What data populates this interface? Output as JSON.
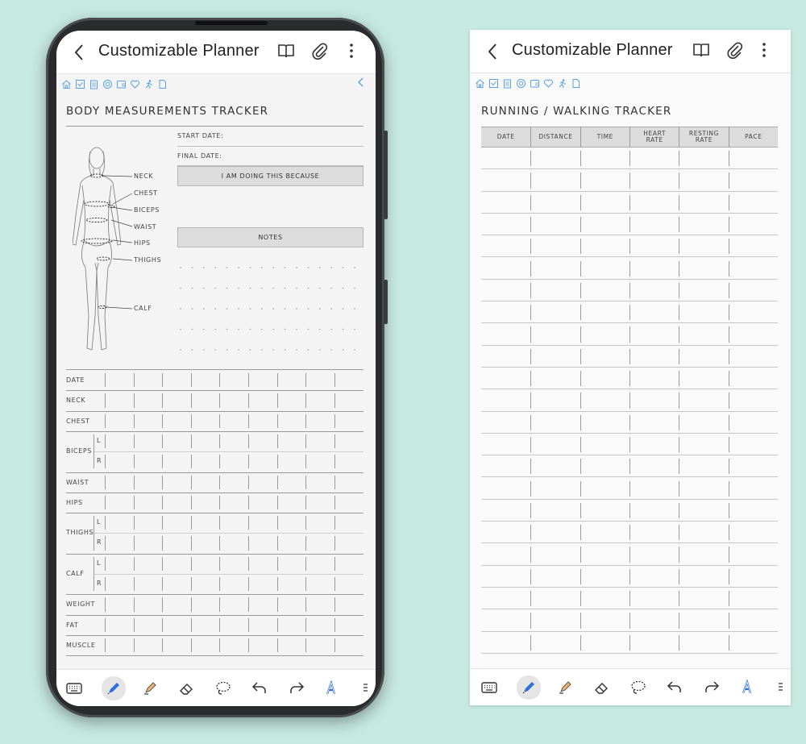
{
  "app_title": "Customizable Planner",
  "nav_icons": [
    "home-icon",
    "inbox-icon",
    "clipboard-icon",
    "target-icon",
    "wallet-icon",
    "heart-icon",
    "run-icon",
    "page-icon"
  ],
  "body_tracker": {
    "title": "BODY MEASUREMENTS TRACKER",
    "start_date": "START DATE:",
    "final_date": "FINAL DATE:",
    "because": "I AM DOING THIS BECAUSE",
    "notes": "NOTES",
    "figure_labels": [
      "NECK",
      "CHEST",
      "BICEPS",
      "WAIST",
      "HIPS",
      "THIGHS",
      "CALF"
    ],
    "rows": [
      {
        "label": "DATE",
        "sub": ""
      },
      {
        "label": "NECK",
        "sub": ""
      },
      {
        "label": "CHEST",
        "sub": ""
      },
      {
        "label": "BICEPS",
        "sub": "L"
      },
      {
        "label": "",
        "sub": "R"
      },
      {
        "label": "WAIST",
        "sub": ""
      },
      {
        "label": "HIPS",
        "sub": ""
      },
      {
        "label": "THIGHS",
        "sub": "L"
      },
      {
        "label": "",
        "sub": "R"
      },
      {
        "label": "CALF",
        "sub": "L"
      },
      {
        "label": "",
        "sub": "R"
      },
      {
        "label": "WEIGHT",
        "sub": ""
      },
      {
        "label": "FAT",
        "sub": ""
      },
      {
        "label": "MUSCLE",
        "sub": ""
      }
    ]
  },
  "run_tracker": {
    "title": "RUNNING / WALKING TRACKER",
    "columns": [
      "DATE",
      "DISTANCE",
      "TIME",
      "HEART\nRATE",
      "RESTING\nRATE",
      "PACE"
    ],
    "row_count": 23
  },
  "toolbar_tools": [
    "keyboard-icon",
    "pen-icon",
    "highlighter-icon",
    "eraser-icon",
    "lasso-icon",
    "undo-icon",
    "redo-icon",
    "handwriting-icon",
    "text-icon"
  ],
  "colors": {
    "accent": "#5aa0e6",
    "pen": "#2f6fd8",
    "highlighter": "#f0b070",
    "header_fill": "#dcdcdc"
  }
}
